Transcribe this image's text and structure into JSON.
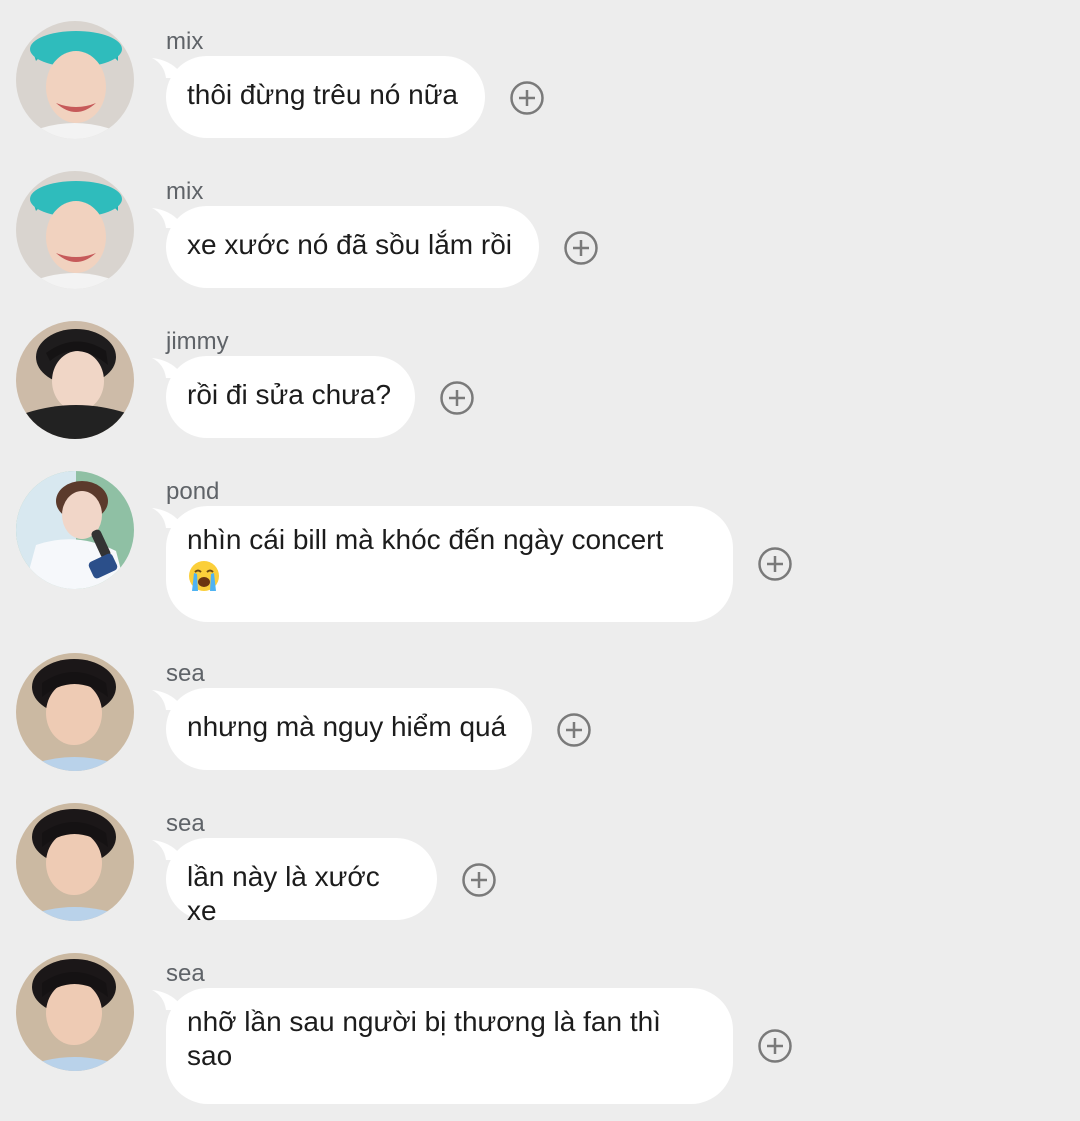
{
  "messages": [
    {
      "sender": "mix",
      "text": "thôi đừng trêu nó nữa",
      "avatar": "mix"
    },
    {
      "sender": "mix",
      "text": "xe xước nó đã sồu lắm rồi",
      "avatar": "mix"
    },
    {
      "sender": "jimmy",
      "text": "rồi đi sửa chưa?",
      "avatar": "jimmy"
    },
    {
      "sender": "pond",
      "text": "nhìn cái bill mà khóc đến ngày concert",
      "emoji": "loudly-crying-face",
      "avatar": "pond"
    },
    {
      "sender": "sea",
      "text": "nhưng mà nguy hiểm quá",
      "avatar": "sea"
    },
    {
      "sender": "sea",
      "text": "lần này là xước xe",
      "avatar": "sea"
    },
    {
      "sender": "sea",
      "text": "nhỡ lần sau người bị thương là fan thì sao",
      "avatar": "sea"
    }
  ],
  "icons": {
    "reaction": "add-reaction-icon"
  },
  "colors": {
    "background": "#ededed",
    "bubble": "#ffffff",
    "sender_text": "#5f6368",
    "message_text": "#1c1c1c",
    "reaction_icon": "#7a7a7a"
  }
}
